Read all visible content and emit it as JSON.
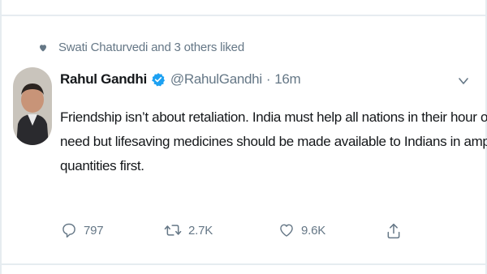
{
  "social_context": {
    "text": "Swati Chaturvedi and 3 others liked",
    "icon": "heart-icon"
  },
  "tweet": {
    "author": {
      "name": "Rahul Gandhi",
      "handle": "@RahulGandhi",
      "verified": true,
      "avatar_icon": "avatar-photo"
    },
    "separator": "·",
    "time": "16m",
    "text_lines": [
      "Friendship isn’t about retaliation. India must help all nations in their hour of",
      "need but lifesaving medicines should be made available to Indians in ample",
      "quantities first."
    ],
    "actions": {
      "replies": "797",
      "retweets": "2.7K",
      "likes": "9.6K"
    }
  },
  "colors": {
    "text_primary": "#14171a",
    "text_secondary": "#657786",
    "verified_blue": "#1da1f2",
    "divider": "#e6ecf0"
  }
}
